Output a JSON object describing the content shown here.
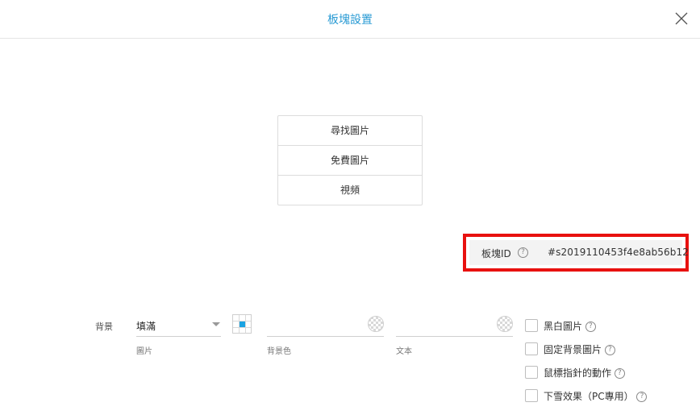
{
  "dialog": {
    "title": "板塊設置",
    "close_icon": "close-icon"
  },
  "image_buttons": [
    {
      "label": "尋找圖片"
    },
    {
      "label": "免費圖片"
    },
    {
      "label": "視頻"
    }
  ],
  "block_id": {
    "label": "板塊ID",
    "help": "?",
    "value": "#s2019110453f4e8ab56b12",
    "highlight_color": "#e8110f"
  },
  "background": {
    "label": "背景",
    "image_fill": {
      "value": "填滿",
      "caption": "圖片"
    },
    "background_color": {
      "value": "",
      "caption": "背景色"
    },
    "text_color": {
      "value": "",
      "caption": "文本"
    },
    "accent_color": "#1aa3e2"
  },
  "options": [
    {
      "label": "黑白圖片",
      "checked": false,
      "help": "?"
    },
    {
      "label": "固定背景圖片",
      "checked": false,
      "help": "?"
    },
    {
      "label": "鼠標指針的動作",
      "checked": false,
      "help": "?"
    },
    {
      "label": "下雪效果（PC專用）",
      "checked": false,
      "help": "?"
    }
  ]
}
